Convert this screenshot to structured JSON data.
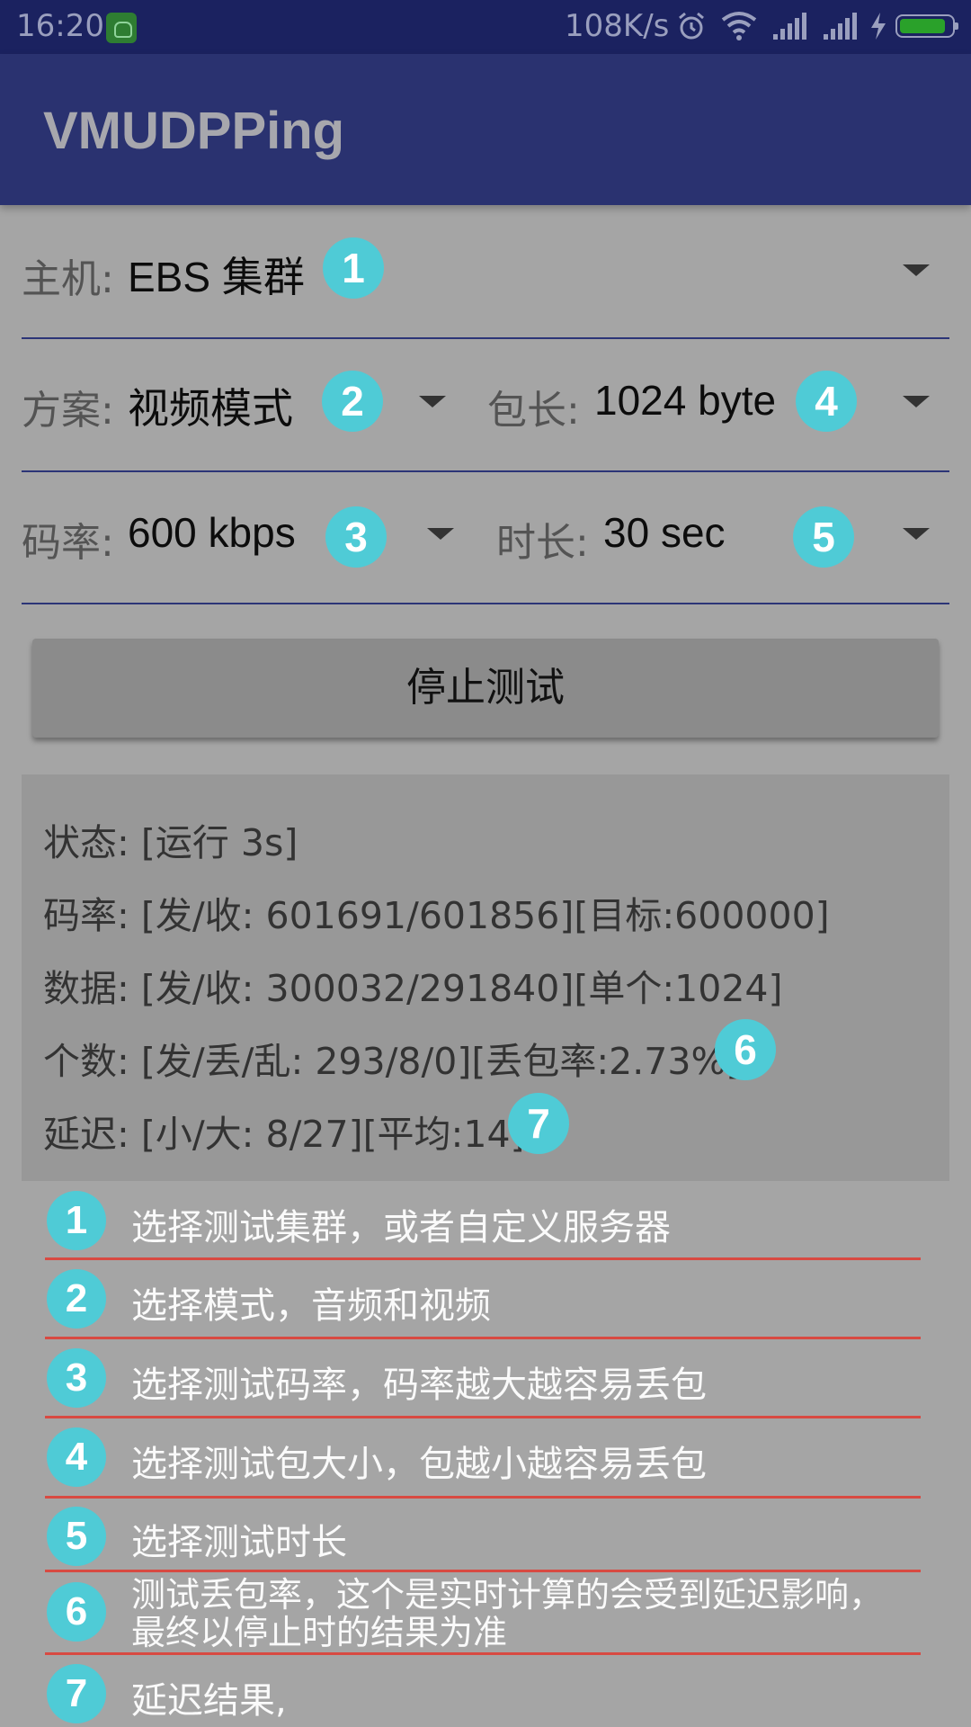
{
  "status_bar": {
    "time": "16:20",
    "speed": "108K/s",
    "icons": [
      "android-app-icon",
      "alarm-icon",
      "wifi-icon",
      "signal-icon",
      "signal-icon",
      "charging-icon",
      "battery-icon"
    ]
  },
  "app_bar": {
    "title": "VMUDPPing"
  },
  "form": {
    "host": {
      "label": "主机:",
      "value": "EBS 集群",
      "badge": "1"
    },
    "scheme": {
      "label": "方案:",
      "value": "视频模式",
      "badge": "2"
    },
    "packet": {
      "label": "包长:",
      "value": "1024 byte",
      "badge": "4"
    },
    "bitrate": {
      "label": "码率:",
      "value": "600 kbps",
      "badge": "3"
    },
    "duration": {
      "label": "时长:",
      "value": "30 sec",
      "badge": "5"
    }
  },
  "stop_button": {
    "label": "停止测试"
  },
  "stats": {
    "status": "状态: [运行 3s]",
    "bitrate": "码率: [发/收: 601691/601856][目标:600000]",
    "data": "数据: [发/收: 300032/291840][单个:1024]",
    "count": "个数: [发/丢/乱: 293/8/0][丢包率:2.73%]",
    "count_badge": "6",
    "latency": "延迟: [小/大: 8/27][平均:14]",
    "latency_badge": "7"
  },
  "legend": [
    {
      "num": "1",
      "text": "选择测试集群，或者自定义服务器"
    },
    {
      "num": "2",
      "text": "选择模式，音频和视频"
    },
    {
      "num": "3",
      "text": "选择测试码率，码率越大越容易丢包"
    },
    {
      "num": "4",
      "text": "选择测试包大小，包越小越容易丢包"
    },
    {
      "num": "5",
      "text": "选择测试时长"
    },
    {
      "num": "6",
      "line1": "测试丢包率，这个是实时计算的会受到延迟影响，",
      "line2": "最终以停止时的结果为准"
    },
    {
      "num": "7",
      "text": "延迟结果,"
    }
  ],
  "colors": {
    "status_bar": "#1b2260",
    "app_bar": "#2a3270",
    "background": "#a5a5a5",
    "badge": "#4fcbd6",
    "legend_divider": "#d84a42",
    "form_divider": "#2c3577"
  }
}
